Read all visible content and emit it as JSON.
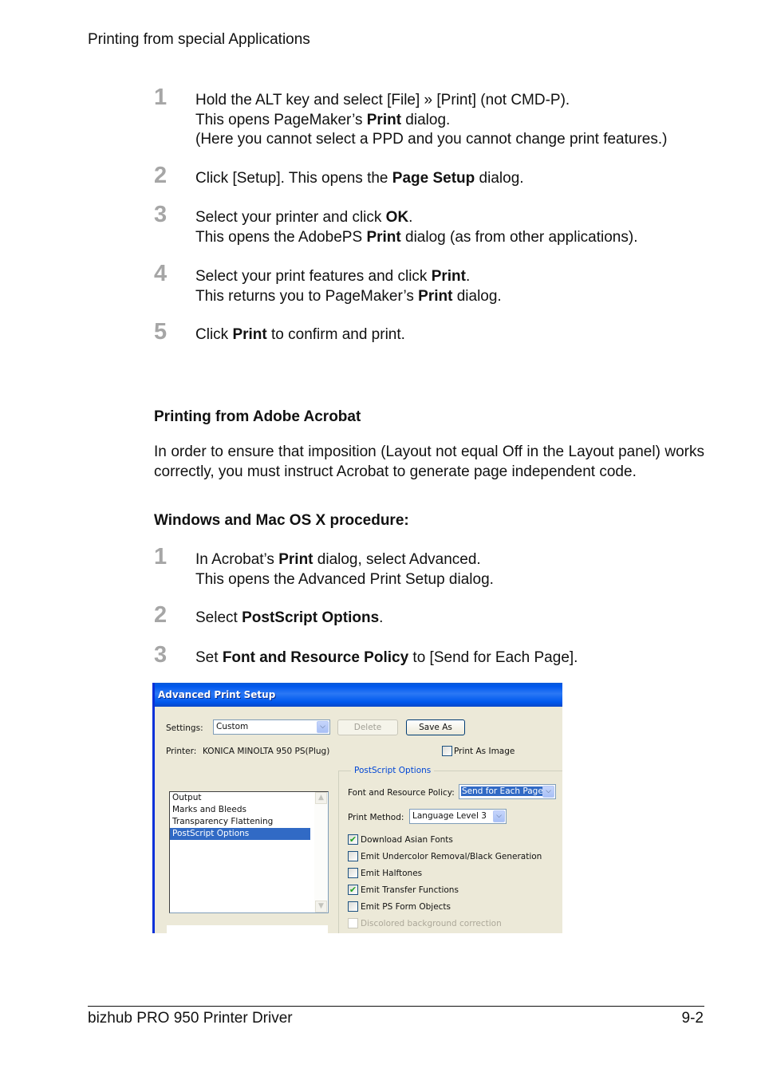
{
  "running_head": "Printing from special Applications",
  "pagemaker_steps": [
    {
      "num": "1",
      "lines": [
        [
          {
            "t": "Hold the ALT key and select [File] » [Print] (not CMD-P)."
          }
        ],
        [
          {
            "t": "This opens PageMaker’s "
          },
          {
            "t": "Print",
            "b": true
          },
          {
            "t": " dialog."
          }
        ],
        [
          {
            "t": "(Here you cannot select a PPD and you cannot change print features.)"
          }
        ]
      ]
    },
    {
      "num": "2",
      "lines": [
        [
          {
            "t": "Click [Setup]. This opens the "
          },
          {
            "t": "Page Setup",
            "b": true
          },
          {
            "t": " dialog."
          }
        ]
      ]
    },
    {
      "num": "3",
      "lines": [
        [
          {
            "t": "Select your printer and click "
          },
          {
            "t": "OK",
            "b": true
          },
          {
            "t": "."
          }
        ],
        [
          {
            "t": "This opens the AdobePS "
          },
          {
            "t": "Print",
            "b": true
          },
          {
            "t": " dialog (as from other applications)."
          }
        ]
      ]
    },
    {
      "num": "4",
      "lines": [
        [
          {
            "t": "Select your print features and click "
          },
          {
            "t": "Print",
            "b": true
          },
          {
            "t": "."
          }
        ],
        [
          {
            "t": "This returns you to PageMaker’s "
          },
          {
            "t": "Print",
            "b": true
          },
          {
            "t": " dialog."
          }
        ]
      ]
    },
    {
      "num": "5",
      "lines": [
        [
          {
            "t": "Click "
          },
          {
            "t": "Print",
            "b": true
          },
          {
            "t": " to confirm and print."
          }
        ]
      ]
    }
  ],
  "acrobat_section": {
    "heading": "Printing from Adobe Acrobat",
    "intro": "In order to ensure that imposition (Layout not equal Off in the Layout panel) works correctly, you must instruct Acrobat to generate page independent code.",
    "procedure_heading": "Windows and Mac OS X  procedure:"
  },
  "acrobat_steps": [
    {
      "num": "1",
      "lines": [
        [
          {
            "t": "In Acrobat’s "
          },
          {
            "t": "Print",
            "b": true
          },
          {
            "t": " dialog, select Advanced."
          }
        ],
        [
          {
            "t": "This opens the Advanced Print Setup dialog."
          }
        ]
      ]
    },
    {
      "num": "2",
      "lines": [
        [
          {
            "t": "Select "
          },
          {
            "t": "PostScript Options",
            "b": true
          },
          {
            "t": "."
          }
        ]
      ]
    },
    {
      "num": "3",
      "lines": [
        [
          {
            "t": "Set "
          },
          {
            "t": "Font and Resource Policy",
            "b": true
          },
          {
            "t": " to [Send for Each Page]."
          }
        ]
      ]
    }
  ],
  "dialog": {
    "title": "Advanced Print Setup",
    "settings_label": "Settings:",
    "settings_value": "Custom",
    "delete_button": "Delete",
    "save_as_button": "Save As",
    "printer_label": "Printer:",
    "printer_value": "KONICA MINOLTA 950 PS(Plug)",
    "print_as_image_label": "Print As Image",
    "print_as_image_checked": false,
    "categories": [
      {
        "label": "Output",
        "selected": false
      },
      {
        "label": "Marks and Bleeds",
        "selected": false
      },
      {
        "label": "Transparency Flattening",
        "selected": false
      },
      {
        "label": "PostScript Options",
        "selected": true
      }
    ],
    "group_label": "PostScript Options",
    "font_policy_label": "Font and Resource Policy:",
    "font_policy_value": "Send for Each Page",
    "print_method_label": "Print Method:",
    "print_method_value": "Language Level 3",
    "options": [
      {
        "label": "Download Asian Fonts",
        "checked": true,
        "disabled": false
      },
      {
        "label": "Emit Undercolor Removal/Black Generation",
        "checked": false,
        "disabled": false
      },
      {
        "label": "Emit Halftones",
        "checked": false,
        "disabled": false
      },
      {
        "label": "Emit Transfer Functions",
        "checked": true,
        "disabled": false
      },
      {
        "label": "Emit PS Form Objects",
        "checked": false,
        "disabled": false
      },
      {
        "label": "Discolored background correction",
        "checked": false,
        "disabled": true
      }
    ],
    "colors": {
      "titlebar": "#0058ee",
      "selection": "#316ac5",
      "check": "#21a121",
      "face": "#ece9d8"
    }
  },
  "footer": {
    "left": "bizhub PRO 950 Printer Driver",
    "right": "9-2"
  }
}
